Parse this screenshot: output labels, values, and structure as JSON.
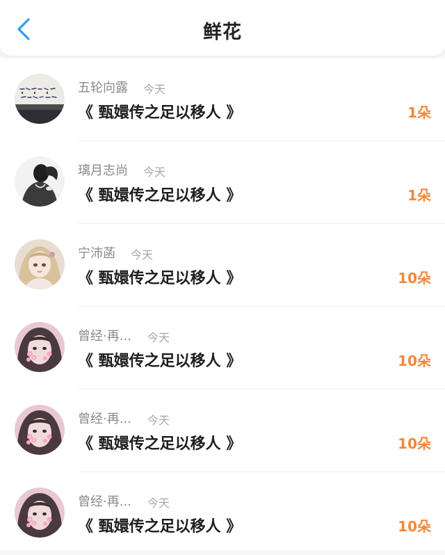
{
  "header": {
    "title": "鲜花",
    "back_icon": "chevron-left-icon",
    "accent_color": "#2a9ff4"
  },
  "flower_list": [
    {
      "username": "五轮向露",
      "time": "今天",
      "work_title": "《 甄嬛传之足以移人 》",
      "count": "1朵",
      "avatar": "calligraphy-avatar-icon"
    },
    {
      "username": "璃月志尚",
      "time": "今天",
      "work_title": "《 甄嬛传之足以移人 》",
      "count": "1朵",
      "avatar": "monochrome-figure-avatar-icon"
    },
    {
      "username": "宁沛菡",
      "time": "今天",
      "work_title": "《 甄嬛传之足以移人 》",
      "count": "10朵",
      "avatar": "anime-girl-avatar-icon"
    },
    {
      "username": "曾经·再...",
      "time": "今天",
      "work_title": "《 甄嬛传之足以移人 》",
      "count": "10朵",
      "avatar": "flower-girl-avatar-icon"
    },
    {
      "username": "曾经·再...",
      "time": "今天",
      "work_title": "《 甄嬛传之足以移人 》",
      "count": "10朵",
      "avatar": "flower-girl-avatar-icon"
    },
    {
      "username": "曾经·再...",
      "time": "今天",
      "work_title": "《 甄嬛传之足以移人 》",
      "count": "10朵",
      "avatar": "flower-girl-avatar-icon"
    }
  ],
  "colors": {
    "count": "#f0883c",
    "username": "#8a8a8a",
    "time": "#a6a6a6",
    "title": "#1e1e1e"
  }
}
